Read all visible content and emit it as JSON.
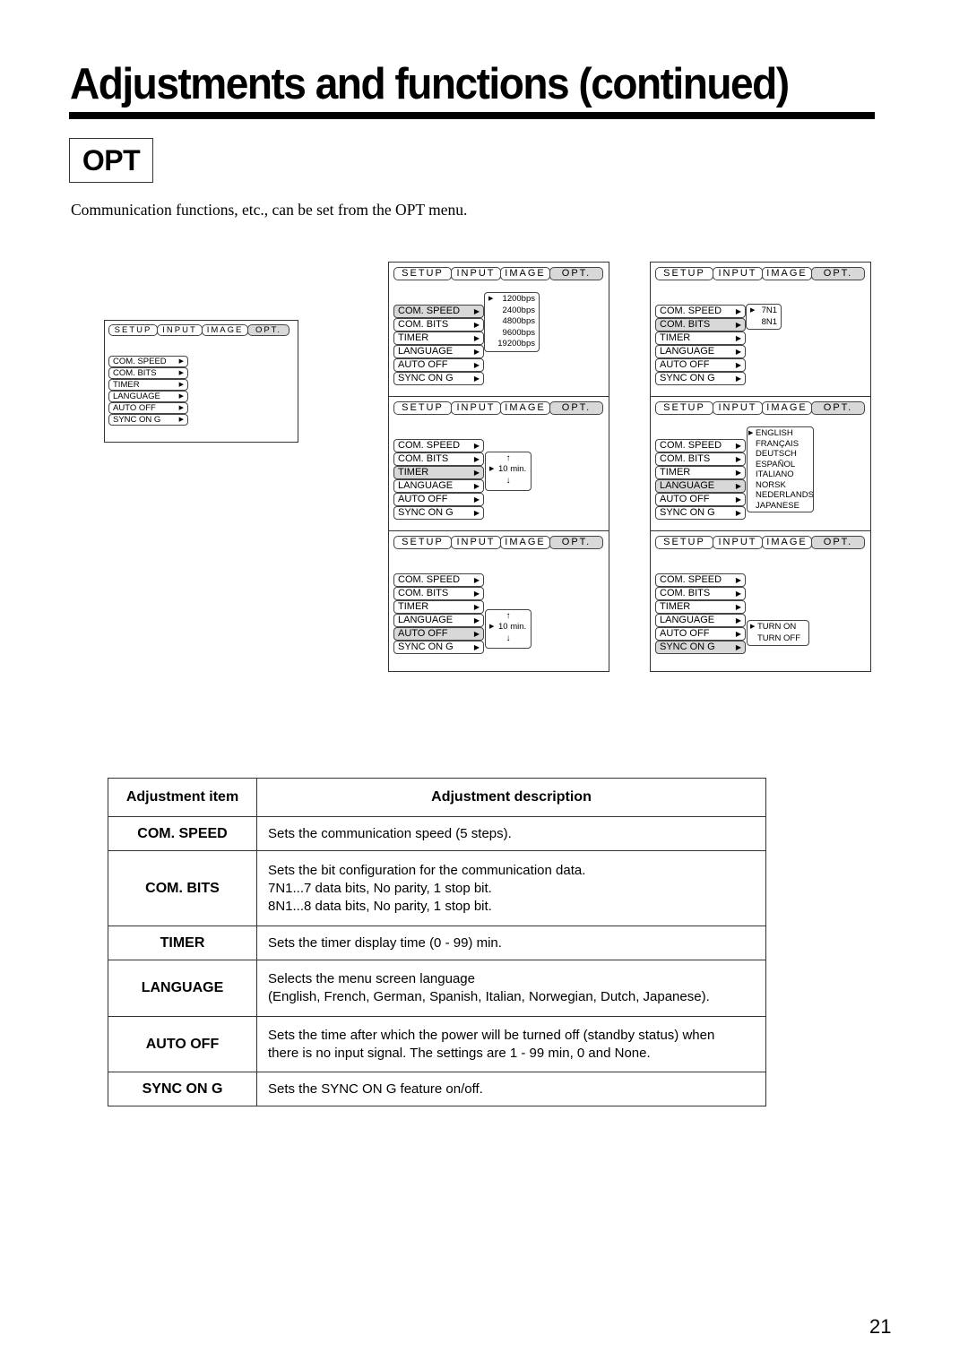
{
  "page": {
    "title": "Adjustments and functions (continued)",
    "section_label": "OPT",
    "intro": "Communication functions, etc., can be set from the OPT menu.",
    "page_number": "21"
  },
  "osd": {
    "tabs": [
      "SETUP",
      "INPUT",
      "IMAGE",
      "OPT."
    ],
    "active_tab": "OPT.",
    "items": [
      "COM. SPEED",
      "COM. BITS",
      "TIMER",
      "LANGUAGE",
      "AUTO OFF",
      "SYNC ON G"
    ],
    "item_arrow": "▶"
  },
  "panels": {
    "main": {
      "selected_item": null
    },
    "com_speed": {
      "selected_item": "COM. SPEED",
      "options": [
        "1200bps",
        "2400bps",
        "4800bps",
        "9600bps",
        "19200bps"
      ],
      "current": "1200bps"
    },
    "com_bits": {
      "selected_item": "COM. BITS",
      "options": [
        "7N1",
        "8N1"
      ],
      "current": "7N1"
    },
    "timer": {
      "selected_item": "TIMER",
      "up": "↑",
      "value": "10  min.",
      "down": "↓"
    },
    "language": {
      "selected_item": "LANGUAGE",
      "options": [
        "ENGLISH",
        "FRANÇAIS",
        "DEUTSCH",
        "ESPAÑOL",
        "ITALIANO",
        "NORSK",
        "NEDERLANDS",
        "JAPANESE"
      ],
      "current": "ENGLISH"
    },
    "auto_off": {
      "selected_item": "AUTO OFF",
      "up": "↑",
      "value": "10  min.",
      "down": "↓"
    },
    "sync_on_g": {
      "selected_item": "SYNC ON G",
      "options": [
        "TURN ON",
        "TURN OFF"
      ],
      "current": "TURN ON"
    }
  },
  "table": {
    "headers": [
      "Adjustment item",
      "Adjustment description"
    ],
    "rows": [
      {
        "item": "COM. SPEED",
        "desc": [
          "Sets the communication speed (5 steps)."
        ]
      },
      {
        "item": "COM. BITS",
        "desc": [
          "Sets the bit configuration for the communication data.",
          "7N1...7 data bits, No parity, 1 stop bit.",
          "8N1...8 data bits, No parity, 1 stop bit."
        ]
      },
      {
        "item": "TIMER",
        "desc": [
          "Sets the timer display time (0 - 99) min."
        ]
      },
      {
        "item": "LANGUAGE",
        "desc": [
          "Selects the menu screen language",
          "(English, French, German, Spanish, Italian, Norwegian, Dutch, Japanese)."
        ]
      },
      {
        "item": "AUTO OFF",
        "desc": [
          "Sets the time after which the power will be turned off (standby status) when",
          "there is no input signal. The settings are 1 - 99 min, 0 and None."
        ]
      },
      {
        "item": "SYNC ON G",
        "desc": [
          "Sets the SYNC ON G feature on/off."
        ]
      }
    ]
  }
}
